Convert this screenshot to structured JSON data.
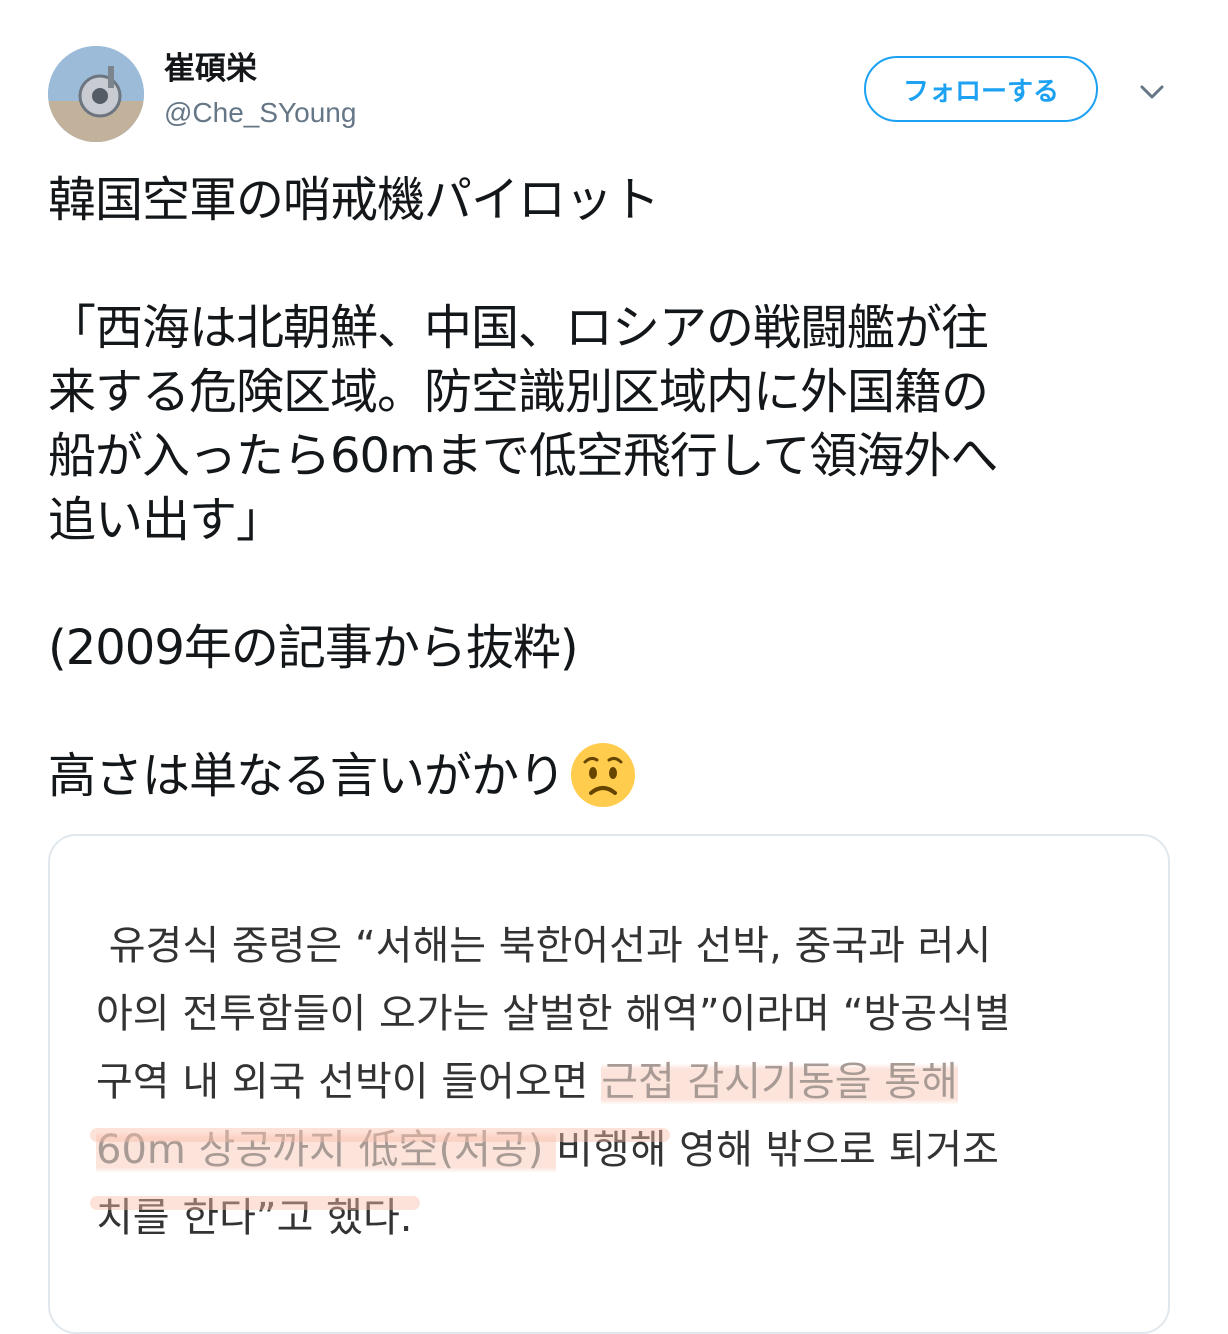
{
  "user": {
    "display_name": "崔碩栄",
    "handle": "@Che_SYoung",
    "avatar_icon": "avatar-image"
  },
  "actions": {
    "follow_label": "フォローする",
    "menu_icon": "chevron-down-icon"
  },
  "colors": {
    "accent": "#1da1f2",
    "text": "#14171a",
    "secondary": "#657786",
    "border": "#e1e8ed",
    "highlight": "#facdbe"
  },
  "tweet": {
    "line1": "韓国空軍の哨戒機パイロット",
    "quote_line1": "「西海は北朝鮮、中国、ロシアの戦闘艦が往",
    "quote_line2": "来する危険区域。防空識別区域内に外国籍の",
    "quote_line3": "船が入ったら60mまで低空飛行して領海外へ",
    "quote_line4": "追い出す」",
    "source": "(2009年の記事から抜粋)",
    "last_line": "高さは単なる言いがかり",
    "emoji_icon": "worried-face-emoji"
  },
  "attachment": {
    "line1": "유경식 중령은 “서해는 북한어선과 선박, 중국과 러시",
    "line2": "아의 전투함들이 오가는 살벌한 해역”이라며 “방공식별",
    "line3_plain": "구역 내 외국 선박이 들어오면 ",
    "line3_hl": "근접 감시기동을 통해",
    "line4_hl": "60m 상공까지 低空(저공) ",
    "line4_plain": "비행해 영해 밖으로 퇴거조",
    "line5": "치를 한다”고 했다."
  }
}
